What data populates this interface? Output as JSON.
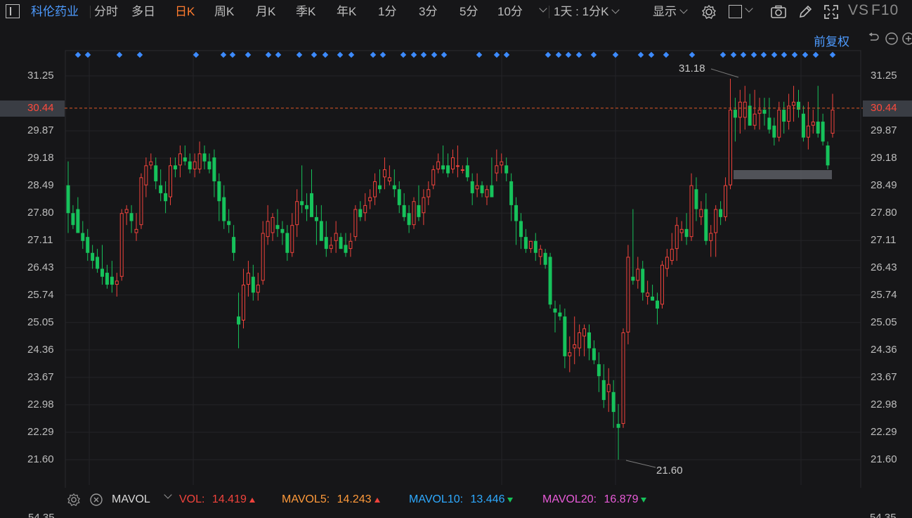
{
  "toolbar": {
    "stock_name": "科伦药业",
    "tabs": [
      "分时",
      "多日",
      "日K",
      "周K",
      "月K",
      "季K",
      "年K",
      "1分",
      "3分",
      "5分"
    ],
    "active_tab": "日K",
    "tf_dropdown": "10分",
    "period_select": "1天 : 1分K",
    "display_menu": "显示",
    "vs_label": "VS",
    "f10_label": "F10"
  },
  "adjust_label": "前复权",
  "price_axis": {
    "ticks": [
      "31.25",
      "29.87",
      "29.18",
      "28.49",
      "27.80",
      "27.11",
      "26.43",
      "25.74",
      "25.05",
      "24.36",
      "23.67",
      "22.98",
      "22.29",
      "21.60"
    ],
    "current_price": "30.44",
    "bottom_partial": "54.35"
  },
  "annotations": {
    "high": "31.18",
    "low": "21.60"
  },
  "indicator_bar": {
    "name": "MAVOL",
    "vol_label": "VOL:",
    "vol_value": "14.419",
    "mavol5_label": "MAVOL5:",
    "mavol5_value": "14.243",
    "mavol10_label": "MAVOL10:",
    "mavol10_value": "13.446",
    "mavol20_label": "MAVOL20:",
    "mavol20_value": "16.879"
  },
  "colors": {
    "up": "#f0433c",
    "down": "#16c25b",
    "accent": "#ff7b2e",
    "link": "#4d9bff",
    "mavol10": "#2eaaff",
    "mavol20": "#e85bd8"
  },
  "icons": [
    "settings-icon",
    "square-icon",
    "camera-icon",
    "pen-icon",
    "fullscreen-icon",
    "undo-icon",
    "minus-circle-icon",
    "plus-circle-icon",
    "close-icon"
  ],
  "chart_data": {
    "type": "candlestick",
    "ylim": [
      21.6,
      31.25
    ],
    "series": [
      {
        "o": 28.5,
        "h": 29.1,
        "l": 27.3,
        "c": 27.8
      },
      {
        "o": 27.8,
        "h": 28.0,
        "l": 27.4,
        "c": 27.5
      },
      {
        "o": 27.9,
        "h": 28.2,
        "l": 27.3,
        "c": 27.3
      },
      {
        "o": 27.3,
        "h": 27.6,
        "l": 26.9,
        "c": 27.1
      },
      {
        "o": 27.2,
        "h": 27.4,
        "l": 26.6,
        "c": 26.8
      },
      {
        "o": 26.8,
        "h": 27.0,
        "l": 26.4,
        "c": 26.6
      },
      {
        "o": 26.7,
        "h": 26.9,
        "l": 26.3,
        "c": 26.4
      },
      {
        "o": 26.4,
        "h": 27.0,
        "l": 26.0,
        "c": 26.2
      },
      {
        "o": 26.3,
        "h": 26.5,
        "l": 25.9,
        "c": 26.0
      },
      {
        "o": 26.2,
        "h": 26.6,
        "l": 25.8,
        "c": 26.0
      },
      {
        "o": 26.0,
        "h": 26.3,
        "l": 25.7,
        "c": 26.1
      },
      {
        "o": 26.2,
        "h": 27.9,
        "l": 26.1,
        "c": 27.8
      },
      {
        "o": 27.8,
        "h": 28.0,
        "l": 27.5,
        "c": 27.9
      },
      {
        "o": 27.8,
        "h": 28.0,
        "l": 27.3,
        "c": 27.6
      },
      {
        "o": 27.3,
        "h": 27.8,
        "l": 27.1,
        "c": 27.4
      },
      {
        "o": 27.5,
        "h": 28.8,
        "l": 27.4,
        "c": 28.7
      },
      {
        "o": 28.5,
        "h": 29.2,
        "l": 28.2,
        "c": 29.0
      },
      {
        "o": 29.0,
        "h": 29.3,
        "l": 28.9,
        "c": 29.1
      },
      {
        "o": 29.0,
        "h": 29.2,
        "l": 28.4,
        "c": 28.6
      },
      {
        "o": 28.5,
        "h": 28.9,
        "l": 28.1,
        "c": 28.3
      },
      {
        "o": 28.3,
        "h": 28.6,
        "l": 27.8,
        "c": 28.1
      },
      {
        "o": 28.2,
        "h": 29.2,
        "l": 28.0,
        "c": 29.0
      },
      {
        "o": 29.0,
        "h": 29.2,
        "l": 28.7,
        "c": 28.9
      },
      {
        "o": 29.0,
        "h": 29.5,
        "l": 28.7,
        "c": 29.3
      },
      {
        "o": 29.2,
        "h": 29.5,
        "l": 29.0,
        "c": 29.1
      },
      {
        "o": 29.1,
        "h": 29.3,
        "l": 28.8,
        "c": 28.9
      },
      {
        "o": 28.9,
        "h": 29.3,
        "l": 28.7,
        "c": 29.1
      },
      {
        "o": 28.9,
        "h": 29.6,
        "l": 28.8,
        "c": 29.3
      },
      {
        "o": 29.3,
        "h": 29.5,
        "l": 28.9,
        "c": 29.1
      },
      {
        "o": 29.1,
        "h": 29.3,
        "l": 28.8,
        "c": 28.9
      },
      {
        "o": 29.2,
        "h": 29.4,
        "l": 28.2,
        "c": 28.6
      },
      {
        "o": 28.6,
        "h": 28.8,
        "l": 27.6,
        "c": 28.1
      },
      {
        "o": 28.2,
        "h": 28.5,
        "l": 27.4,
        "c": 27.6
      },
      {
        "o": 27.6,
        "h": 27.9,
        "l": 27.3,
        "c": 27.5
      },
      {
        "o": 27.2,
        "h": 27.5,
        "l": 26.6,
        "c": 26.8
      },
      {
        "o": 25.2,
        "h": 25.8,
        "l": 24.4,
        "c": 25.0
      },
      {
        "o": 25.1,
        "h": 26.4,
        "l": 24.9,
        "c": 26.0
      },
      {
        "o": 26.0,
        "h": 26.6,
        "l": 25.7,
        "c": 26.3
      },
      {
        "o": 26.2,
        "h": 26.5,
        "l": 25.6,
        "c": 25.8
      },
      {
        "o": 25.8,
        "h": 26.3,
        "l": 25.6,
        "c": 26.0
      },
      {
        "o": 26.1,
        "h": 27.6,
        "l": 26.0,
        "c": 27.3
      },
      {
        "o": 27.2,
        "h": 28.0,
        "l": 27.0,
        "c": 27.6
      },
      {
        "o": 27.3,
        "h": 27.8,
        "l": 27.1,
        "c": 27.7
      },
      {
        "o": 27.5,
        "h": 27.9,
        "l": 27.2,
        "c": 27.4
      },
      {
        "o": 27.4,
        "h": 27.6,
        "l": 27.0,
        "c": 27.3
      },
      {
        "o": 27.3,
        "h": 27.5,
        "l": 26.6,
        "c": 26.8
      },
      {
        "o": 26.8,
        "h": 27.8,
        "l": 26.7,
        "c": 27.5
      },
      {
        "o": 27.5,
        "h": 28.4,
        "l": 27.2,
        "c": 28.1
      },
      {
        "o": 28.1,
        "h": 29.0,
        "l": 27.8,
        "c": 28.0
      },
      {
        "o": 28.0,
        "h": 28.3,
        "l": 27.6,
        "c": 27.9
      },
      {
        "o": 28.3,
        "h": 28.9,
        "l": 28.0,
        "c": 27.7
      },
      {
        "o": 27.7,
        "h": 28.0,
        "l": 27.0,
        "c": 27.6
      },
      {
        "o": 27.6,
        "h": 28.0,
        "l": 27.3,
        "c": 27.1
      },
      {
        "o": 27.2,
        "h": 27.6,
        "l": 26.7,
        "c": 26.9
      },
      {
        "o": 26.9,
        "h": 27.2,
        "l": 26.8,
        "c": 27.0
      },
      {
        "o": 27.1,
        "h": 27.6,
        "l": 26.8,
        "c": 27.3
      },
      {
        "o": 27.2,
        "h": 27.3,
        "l": 26.9,
        "c": 26.9
      },
      {
        "o": 27.0,
        "h": 27.3,
        "l": 26.7,
        "c": 26.8
      },
      {
        "o": 26.9,
        "h": 27.3,
        "l": 26.7,
        "c": 27.1
      },
      {
        "o": 27.2,
        "h": 28.0,
        "l": 27.1,
        "c": 27.9
      },
      {
        "o": 27.9,
        "h": 28.1,
        "l": 27.6,
        "c": 27.7
      },
      {
        "o": 27.8,
        "h": 28.3,
        "l": 27.6,
        "c": 28.0
      },
      {
        "o": 28.1,
        "h": 28.4,
        "l": 27.9,
        "c": 28.2
      },
      {
        "o": 28.2,
        "h": 28.8,
        "l": 28.0,
        "c": 28.6
      },
      {
        "o": 28.5,
        "h": 28.9,
        "l": 28.3,
        "c": 28.4
      },
      {
        "o": 28.7,
        "h": 29.2,
        "l": 28.4,
        "c": 28.9
      },
      {
        "o": 28.6,
        "h": 29.0,
        "l": 28.5,
        "c": 28.7
      },
      {
        "o": 28.5,
        "h": 28.9,
        "l": 28.2,
        "c": 28.4
      },
      {
        "o": 28.4,
        "h": 28.6,
        "l": 27.8,
        "c": 28.0
      },
      {
        "o": 28.0,
        "h": 28.3,
        "l": 27.6,
        "c": 27.7
      },
      {
        "o": 27.8,
        "h": 28.0,
        "l": 27.3,
        "c": 27.5
      },
      {
        "o": 27.5,
        "h": 28.2,
        "l": 27.4,
        "c": 28.1
      },
      {
        "o": 28.0,
        "h": 28.5,
        "l": 27.6,
        "c": 27.7
      },
      {
        "o": 27.8,
        "h": 28.4,
        "l": 27.5,
        "c": 28.2
      },
      {
        "o": 28.2,
        "h": 28.6,
        "l": 28.0,
        "c": 28.4
      },
      {
        "o": 28.5,
        "h": 29.0,
        "l": 28.4,
        "c": 28.9
      },
      {
        "o": 28.9,
        "h": 29.3,
        "l": 28.8,
        "c": 29.1
      },
      {
        "o": 29.0,
        "h": 29.5,
        "l": 28.8,
        "c": 28.9
      },
      {
        "o": 29.0,
        "h": 29.3,
        "l": 28.7,
        "c": 28.8
      },
      {
        "o": 28.9,
        "h": 29.4,
        "l": 28.8,
        "c": 29.2
      },
      {
        "o": 29.0,
        "h": 29.5,
        "l": 28.7,
        "c": 29.0
      },
      {
        "o": 28.9,
        "h": 29.0,
        "l": 28.8,
        "c": 28.9
      },
      {
        "o": 29.0,
        "h": 29.2,
        "l": 28.6,
        "c": 28.7
      },
      {
        "o": 28.6,
        "h": 28.8,
        "l": 28.0,
        "c": 28.3
      },
      {
        "o": 28.4,
        "h": 28.8,
        "l": 28.2,
        "c": 28.5
      },
      {
        "o": 28.5,
        "h": 28.6,
        "l": 28.2,
        "c": 28.3
      },
      {
        "o": 28.2,
        "h": 28.5,
        "l": 28.0,
        "c": 28.4
      },
      {
        "o": 28.5,
        "h": 29.2,
        "l": 28.2,
        "c": 28.2
      },
      {
        "o": 28.8,
        "h": 29.4,
        "l": 28.6,
        "c": 29.0
      },
      {
        "o": 29.0,
        "h": 29.3,
        "l": 28.8,
        "c": 29.1
      },
      {
        "o": 29.0,
        "h": 29.2,
        "l": 28.6,
        "c": 28.8
      },
      {
        "o": 28.6,
        "h": 28.8,
        "l": 27.6,
        "c": 28.0
      },
      {
        "o": 28.0,
        "h": 28.2,
        "l": 27.0,
        "c": 27.6
      },
      {
        "o": 27.6,
        "h": 27.8,
        "l": 26.9,
        "c": 27.2
      },
      {
        "o": 27.2,
        "h": 27.4,
        "l": 26.8,
        "c": 26.9
      },
      {
        "o": 26.9,
        "h": 27.1,
        "l": 26.8,
        "c": 27.1
      },
      {
        "o": 27.1,
        "h": 27.3,
        "l": 26.6,
        "c": 26.8
      },
      {
        "o": 26.7,
        "h": 27.0,
        "l": 26.5,
        "c": 26.9
      },
      {
        "o": 26.8,
        "h": 26.9,
        "l": 26.4,
        "c": 26.5
      },
      {
        "o": 26.7,
        "h": 26.8,
        "l": 25.4,
        "c": 25.5
      },
      {
        "o": 25.4,
        "h": 25.6,
        "l": 24.8,
        "c": 25.3
      },
      {
        "o": 25.3,
        "h": 25.5,
        "l": 25.1,
        "c": 25.2
      },
      {
        "o": 25.2,
        "h": 25.4,
        "l": 23.9,
        "c": 24.2
      },
      {
        "o": 24.2,
        "h": 24.7,
        "l": 23.8,
        "c": 24.3
      },
      {
        "o": 24.4,
        "h": 25.2,
        "l": 24.0,
        "c": 24.5
      },
      {
        "o": 24.4,
        "h": 25.0,
        "l": 24.2,
        "c": 24.8
      },
      {
        "o": 24.7,
        "h": 25.0,
        "l": 24.2,
        "c": 24.9
      },
      {
        "o": 24.8,
        "h": 25.0,
        "l": 24.1,
        "c": 24.4
      },
      {
        "o": 24.4,
        "h": 24.6,
        "l": 24.0,
        "c": 24.1
      },
      {
        "o": 24.0,
        "h": 24.3,
        "l": 23.3,
        "c": 23.7
      },
      {
        "o": 23.6,
        "h": 24.0,
        "l": 22.9,
        "c": 23.1
      },
      {
        "o": 23.3,
        "h": 23.9,
        "l": 22.8,
        "c": 23.5
      },
      {
        "o": 23.3,
        "h": 23.6,
        "l": 22.4,
        "c": 22.8
      },
      {
        "o": 22.5,
        "h": 23.0,
        "l": 21.6,
        "c": 22.4
      },
      {
        "o": 22.5,
        "h": 24.9,
        "l": 22.4,
        "c": 24.8
      },
      {
        "o": 24.8,
        "h": 27.0,
        "l": 24.5,
        "c": 26.7
      },
      {
        "o": 26.2,
        "h": 27.9,
        "l": 26.0,
        "c": 26.1
      },
      {
        "o": 26.1,
        "h": 26.7,
        "l": 25.9,
        "c": 26.4
      },
      {
        "o": 26.4,
        "h": 26.6,
        "l": 25.6,
        "c": 25.8
      },
      {
        "o": 25.7,
        "h": 26.1,
        "l": 25.5,
        "c": 25.8
      },
      {
        "o": 25.7,
        "h": 26.0,
        "l": 25.6,
        "c": 25.6
      },
      {
        "o": 25.6,
        "h": 25.8,
        "l": 25.0,
        "c": 25.4
      },
      {
        "o": 25.5,
        "h": 26.6,
        "l": 25.4,
        "c": 26.5
      },
      {
        "o": 26.4,
        "h": 26.9,
        "l": 26.2,
        "c": 26.7
      },
      {
        "o": 26.6,
        "h": 27.3,
        "l": 26.5,
        "c": 26.9
      },
      {
        "o": 26.9,
        "h": 27.7,
        "l": 26.6,
        "c": 27.5
      },
      {
        "o": 27.3,
        "h": 27.6,
        "l": 27.1,
        "c": 27.4
      },
      {
        "o": 27.4,
        "h": 27.8,
        "l": 27.0,
        "c": 27.2
      },
      {
        "o": 27.2,
        "h": 28.8,
        "l": 27.1,
        "c": 28.5
      },
      {
        "o": 28.4,
        "h": 28.7,
        "l": 27.6,
        "c": 27.9
      },
      {
        "o": 27.7,
        "h": 28.1,
        "l": 27.5,
        "c": 27.9
      },
      {
        "o": 27.9,
        "h": 28.3,
        "l": 27.0,
        "c": 27.1
      },
      {
        "o": 27.1,
        "h": 27.5,
        "l": 26.7,
        "c": 27.3
      },
      {
        "o": 27.3,
        "h": 28.0,
        "l": 26.7,
        "c": 27.9
      },
      {
        "o": 27.9,
        "h": 28.1,
        "l": 27.5,
        "c": 27.7
      },
      {
        "o": 27.7,
        "h": 28.7,
        "l": 27.6,
        "c": 28.5
      },
      {
        "o": 28.5,
        "h": 31.18,
        "l": 28.4,
        "c": 30.4
      },
      {
        "o": 30.4,
        "h": 30.7,
        "l": 29.6,
        "c": 30.2
      },
      {
        "o": 30.2,
        "h": 30.9,
        "l": 29.8,
        "c": 30.6
      },
      {
        "o": 30.2,
        "h": 31.0,
        "l": 29.9,
        "c": 30.6
      },
      {
        "o": 30.5,
        "h": 30.8,
        "l": 30.0,
        "c": 30.0
      },
      {
        "o": 30.0,
        "h": 30.9,
        "l": 29.9,
        "c": 30.3
      },
      {
        "o": 30.3,
        "h": 30.7,
        "l": 29.9,
        "c": 30.4
      },
      {
        "o": 30.4,
        "h": 30.7,
        "l": 30.0,
        "c": 30.3
      },
      {
        "o": 30.2,
        "h": 30.7,
        "l": 29.8,
        "c": 29.9
      },
      {
        "o": 30.0,
        "h": 30.2,
        "l": 29.5,
        "c": 29.7
      },
      {
        "o": 29.7,
        "h": 30.6,
        "l": 29.6,
        "c": 30.4
      },
      {
        "o": 30.4,
        "h": 30.6,
        "l": 29.8,
        "c": 30.1
      },
      {
        "o": 30.1,
        "h": 30.8,
        "l": 29.9,
        "c": 30.5
      },
      {
        "o": 30.5,
        "h": 31.0,
        "l": 30.1,
        "c": 30.6
      },
      {
        "o": 30.6,
        "h": 30.9,
        "l": 30.2,
        "c": 30.4
      },
      {
        "o": 30.3,
        "h": 30.5,
        "l": 29.6,
        "c": 29.7
      },
      {
        "o": 29.7,
        "h": 30.6,
        "l": 29.4,
        "c": 30.0
      },
      {
        "o": 30.0,
        "h": 30.4,
        "l": 29.8,
        "c": 30.1
      },
      {
        "o": 30.1,
        "h": 31.0,
        "l": 29.7,
        "c": 29.8
      },
      {
        "o": 30.1,
        "h": 30.3,
        "l": 29.5,
        "c": 29.6
      },
      {
        "o": 29.5,
        "h": 29.6,
        "l": 28.9,
        "c": 29.0
      },
      {
        "o": 29.8,
        "h": 30.8,
        "l": 29.7,
        "c": 30.4
      }
    ]
  }
}
